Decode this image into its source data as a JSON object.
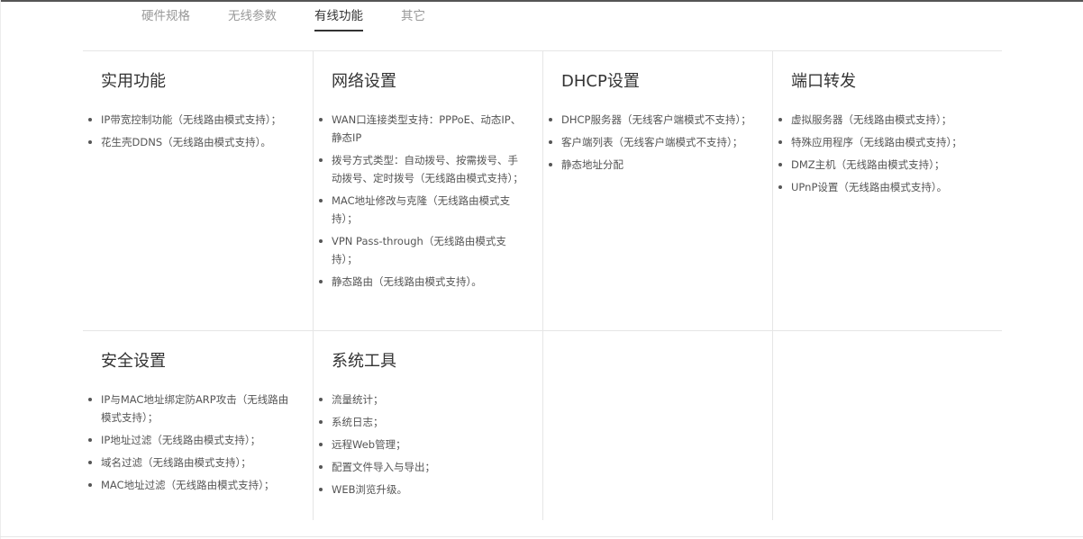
{
  "tabs": [
    {
      "label": "硬件规格",
      "active": false
    },
    {
      "label": "无线参数",
      "active": false
    },
    {
      "label": "有线功能",
      "active": true
    },
    {
      "label": "其它",
      "active": false
    }
  ],
  "sections": [
    {
      "title": "实用功能",
      "items": [
        "IP带宽控制功能（无线路由模式支持）；",
        "花生壳DDNS（无线路由模式支持）。"
      ]
    },
    {
      "title": "网络设置",
      "items": [
        "WAN口连接类型支持：PPPoE、动态IP、静态IP",
        "拨号方式类型：自动拨号、按需拨号、手动拨号、定时拨号（无线路由模式支持）；",
        "MAC地址修改与克隆（无线路由模式支持）；",
        "VPN Pass-through（无线路由模式支持）；",
        "静态路由（无线路由模式支持）。"
      ]
    },
    {
      "title": "DHCP设置",
      "items": [
        "DHCP服务器（无线客户端模式不支持）；",
        "客户端列表（无线客户端模式不支持）；",
        "静态地址分配"
      ]
    },
    {
      "title": "端口转发",
      "items": [
        "虚拟服务器（无线路由模式支持）；",
        "特殊应用程序（无线路由模式支持）；",
        "DMZ主机（无线路由模式支持）；",
        "UPnP设置（无线路由模式支持）。"
      ]
    },
    {
      "title": "安全设置",
      "items": [
        "IP与MAC地址绑定防ARP攻击（无线路由模式支持）；",
        "IP地址过滤（无线路由模式支持）；",
        "域名过滤（无线路由模式支持）；",
        "MAC地址过滤（无线路由模式支持）；"
      ]
    },
    {
      "title": "系统工具",
      "items": [
        "流量统计；",
        "系统日志；",
        "远程Web管理；",
        "配置文件导入与导出；",
        "WEB浏览升级。"
      ]
    },
    {
      "title": "",
      "items": []
    },
    {
      "title": "",
      "items": []
    }
  ]
}
